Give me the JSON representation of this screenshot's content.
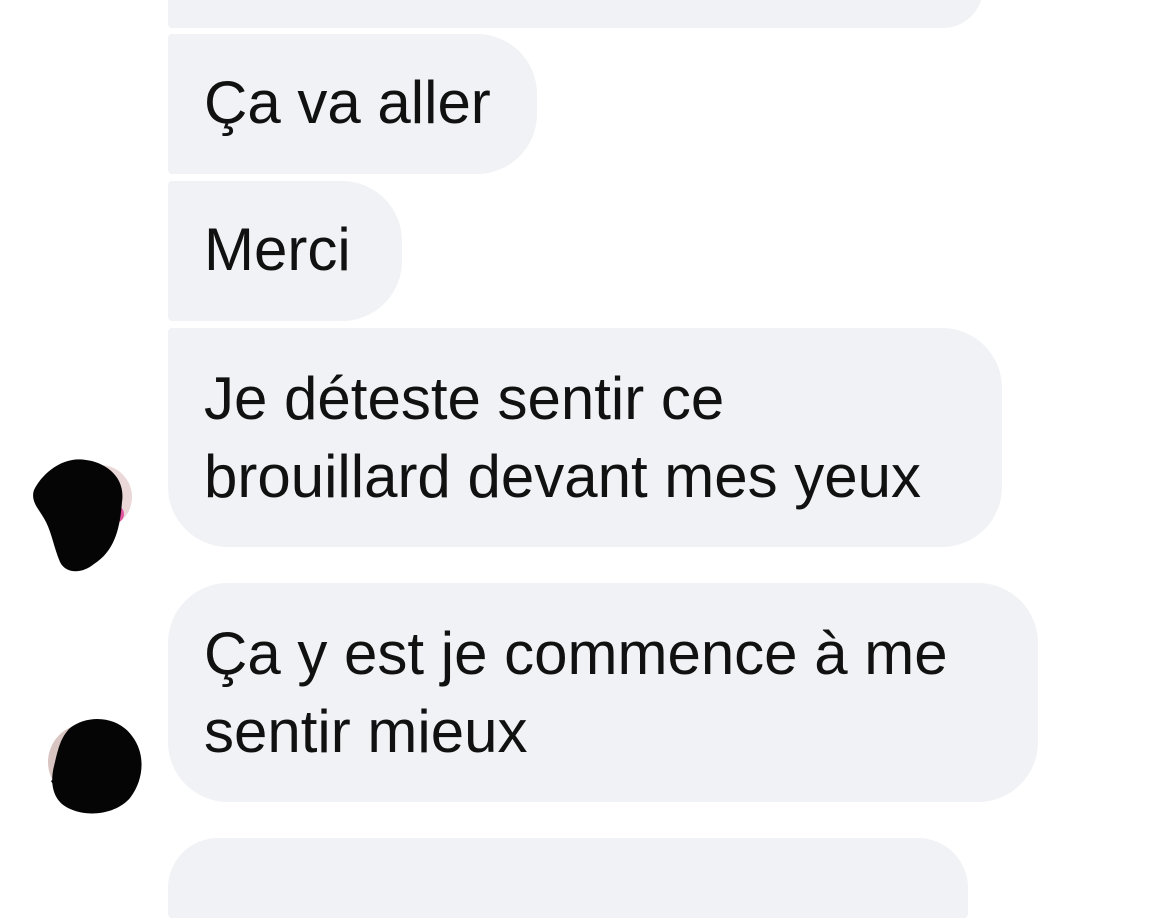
{
  "conversation": {
    "messages": [
      {
        "id": "msg-partial-top",
        "lines": []
      },
      {
        "id": "msg-1",
        "lines": [
          "Ça va aller"
        ]
      },
      {
        "id": "msg-2",
        "lines": [
          "Merci"
        ]
      },
      {
        "id": "msg-3",
        "lines": [
          "Je déteste sentir ce",
          "brouillard devant mes yeux"
        ]
      },
      {
        "id": "msg-4",
        "lines": [
          "Ça y est je commence à me",
          "sentir mieux"
        ]
      },
      {
        "id": "msg-partial-bottom",
        "lines": []
      }
    ]
  },
  "colors": {
    "bubble_background": "#f1f2f5",
    "text": "#111111",
    "avatar_scribble": "#050505"
  },
  "icons": {
    "sender_avatar": "redacted-profile-photo"
  }
}
